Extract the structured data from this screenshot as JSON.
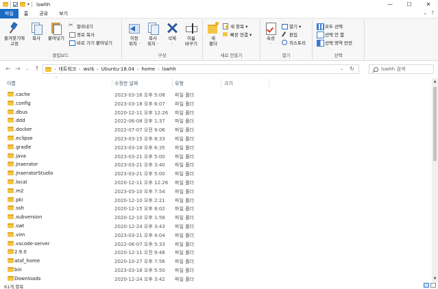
{
  "window": {
    "title": "lswhh",
    "controls": {
      "minimize": "—",
      "maximize": "☐",
      "close": "✕"
    }
  },
  "tabs": [
    {
      "label": "파일",
      "active": true
    },
    {
      "label": "홈"
    },
    {
      "label": "공유"
    },
    {
      "label": "보기"
    }
  ],
  "tabs_right": {
    "expand": "⌄",
    "help": "?"
  },
  "ribbon": {
    "clipboard": {
      "label": "클립보드",
      "pin": "즐겨찾기에\n고정",
      "copy": "복사",
      "paste": "붙여넣기",
      "cut": "잘라내기",
      "copy_path": "경로 복사",
      "paste_shortcut": "바로 가기 붙여넣기"
    },
    "organize": {
      "label": "구성",
      "move_to": "이동\n위치 ·",
      "copy_to": "복사\n위치 ·",
      "delete": "삭제\n·",
      "rename": "이름\n바꾸기"
    },
    "new": {
      "label": "새로 만들기",
      "new_folder": "새\n폴더",
      "new_item": "새 항목 ▾",
      "easy_access": "빠른 연결 ▾"
    },
    "open": {
      "label": "열기",
      "properties": "속성\n·",
      "open": "열기 ▾",
      "edit": "편집",
      "history": "히스토리"
    },
    "select": {
      "label": "선택",
      "select_all": "모두 선택",
      "select_none": "선택 안 함",
      "invert": "선택 영역 반전"
    }
  },
  "nav": {
    "back": "←",
    "forward": "→",
    "recent": "⌄",
    "up": "↑"
  },
  "address": {
    "crumbs": [
      "네트워크",
      "wsl$",
      "Ubuntu-18.04",
      "home",
      "lswhh"
    ],
    "separator": "›",
    "dropdown": "⌄",
    "refresh": "↻"
  },
  "search": {
    "placeholder": "lswhh 검색"
  },
  "columns": {
    "name": "이름",
    "date": "수정한 날짜",
    "type": "유형",
    "size": "크기",
    "sort_indicator": "^"
  },
  "files": [
    {
      "name": ".cache",
      "date": "2023-03-16 오후 5:08",
      "type": "파일 폴더"
    },
    {
      "name": ".config",
      "date": "2023-03-18 오후 6:07",
      "type": "파일 폴더"
    },
    {
      "name": ".dbus",
      "date": "2020-12-11 오후 12:26",
      "type": "파일 폴더"
    },
    {
      "name": ".ddd",
      "date": "2022-06-08 오후 1:37",
      "type": "파일 폴더"
    },
    {
      "name": ".docker",
      "date": "2022-07-07 오전 9:06",
      "type": "파일 폴더"
    },
    {
      "name": ".eclipse",
      "date": "2023-03-15 오후 8:33",
      "type": "파일 폴더"
    },
    {
      "name": ".gradle",
      "date": "2023-03-18 오후 6:35",
      "type": "파일 폴더"
    },
    {
      "name": ".java",
      "date": "2023-03-21 오후 5:00",
      "type": "파일 폴더"
    },
    {
      "name": ".jnaerator",
      "date": "2023-03-21 오후 3:40",
      "type": "파일 폴더"
    },
    {
      "name": ".jnaeratorStudio",
      "date": "2023-03-21 오후 5:00",
      "type": "파일 폴더"
    },
    {
      "name": ".local",
      "date": "2020-12-11 오후 12:26",
      "type": "파일 폴더"
    },
    {
      "name": ".m2",
      "date": "2023-03-10 오후 7:54",
      "type": "파일 폴더"
    },
    {
      "name": ".pki",
      "date": "2020-12-10 오후 2:21",
      "type": "파일 폴더"
    },
    {
      "name": ".ssh",
      "date": "2020-12-15 오후 8:02",
      "type": "파일 폴더"
    },
    {
      "name": ".subversion",
      "date": "2020-12-10 오후 1:58",
      "type": "파일 폴더"
    },
    {
      "name": ".swt",
      "date": "2020-12-24 오후 3:43",
      "type": "파일 폴더"
    },
    {
      "name": ".vim",
      "date": "2023-03-21 오후 4:04",
      "type": "파일 폴더"
    },
    {
      "name": ".vscode-server",
      "date": "2022-06-07 오후 5:33",
      "type": "파일 폴더"
    },
    {
      "name": "2.9.0",
      "date": "2020-12-11 오전 9:48",
      "type": "파일 폴더"
    },
    {
      "name": "ataf_home",
      "date": "2020-10-27 오후 7:56",
      "type": "파일 폴더"
    },
    {
      "name": "bin",
      "date": "2023-03-18 오후 5:50",
      "type": "파일 폴더"
    },
    {
      "name": "Downloads",
      "date": "2020-12-24 오후 3:42",
      "type": "파일 폴더"
    }
  ],
  "status": {
    "item_count": "61개 항목"
  },
  "colors": {
    "file_tab": "#1c6cc4",
    "folder": "#f4c542"
  }
}
